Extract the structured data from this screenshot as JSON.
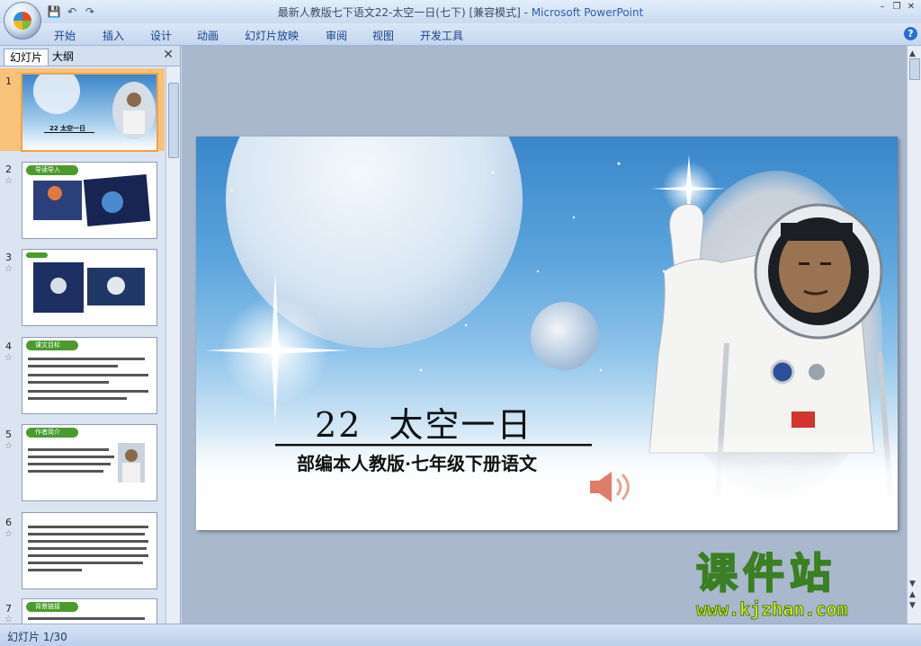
{
  "window": {
    "title": "最新人教版七下语文22-太空一日(七下) [兼容模式]",
    "app": "Microsoft PowerPoint",
    "separator": " - "
  },
  "qat": {
    "save": "💾",
    "undo": "↶",
    "redo": "↷"
  },
  "menu": [
    "开始",
    "插入",
    "设计",
    "动画",
    "幻灯片放映",
    "审阅",
    "视图",
    "开发工具"
  ],
  "help": "?",
  "panel": {
    "tab_slides": "幻灯片",
    "tab_outline": "大纲",
    "close": "✕"
  },
  "thumbnails": [
    {
      "num": "1",
      "title": "22 太空一日"
    },
    {
      "num": "2",
      "title": "导读导入"
    },
    {
      "num": "3",
      "title": ""
    },
    {
      "num": "4",
      "title": "课文目标"
    },
    {
      "num": "5",
      "title": "作者简介"
    },
    {
      "num": "6",
      "title": ""
    },
    {
      "num": "7",
      "title": "背景链接"
    }
  ],
  "slide": {
    "title_num": "22",
    "title": "太空一日",
    "subtitle": "部编本人教版·七年级下册语文"
  },
  "status": {
    "slide_counter": "幻灯片 1/30"
  },
  "watermark": {
    "name": "课件站",
    "url": "www.kjzhan.com"
  },
  "colors": {
    "accent": "#15428b",
    "selection": "#f9c27a"
  }
}
